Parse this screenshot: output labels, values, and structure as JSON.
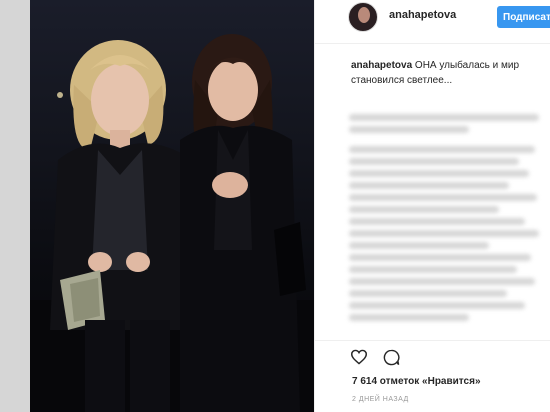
{
  "post": {
    "username": "anahapetova",
    "follow_label": "Подписат",
    "caption_user": "anahapetova",
    "caption_text": " ОНА улыбалась и мир становился светлее...",
    "likes": "7 614 отметок «Нравится»",
    "time": "2 ДНЕЙ НАЗАД"
  },
  "icons": {
    "like": "heart-icon",
    "comment": "comment-icon"
  },
  "colors": {
    "follow_button": "#3897f0",
    "text": "#262626",
    "muted": "#999999"
  }
}
